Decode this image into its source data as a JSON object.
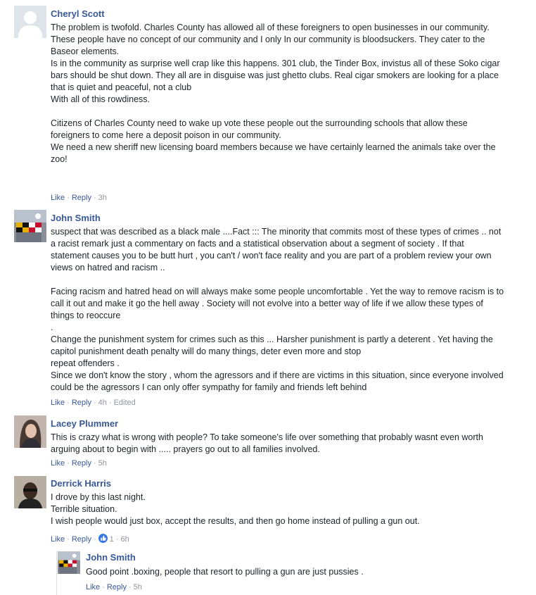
{
  "comments": [
    {
      "author": "Cheryl Scott",
      "text": "The problem is twofold. Charles County has allowed all of these foreigners to open businesses in our community.\nThese people have no concept of our community and I only In our community is bloodsuckers. They cater to the\nBaseor elements.\nIs in the community as surprise well crap like this happens. 301 club, the Tinder Box, invistus all of these Soko cigar\nbars should be shut down. They all are in disguise was just ghetto clubs. Real cigar smokers are looking for a place\nthat is quiet and peaceful, not a club\nWith all of this rowdiness.\n\nCitizens of Charles County need to wake up vote these people out the surrounding schools that allow these\nforeigners to come here a deposit poison in our community.\nWe need a new sheriff new licensing board members because we have certainly learned the animals take over the\nzoo!\n\n\n.",
      "like": "Like",
      "reply": "Reply",
      "time": "3h"
    },
    {
      "author": "John Smith",
      "text": "suspect that was described as a black male ....Fact ::: The minority that commits most of these types of crimes .. not\na racist remark just a commentary on facts and a statistical observation about a segment of society . If that\nstatement causes you to be butt hurt , you can't / won't face reality and you are part of a problem review your own\nviews on hatred and racism ..\n\nFacing racism and hatred head on will always make some people uncomfortable . Yet the way to remove racism is to\ncall it out and make it go the hell away . Society will not evolve into a better way of life if we allow these types of\nthings to reoccure\n.\nChange the punishment system for crimes such as this ... Harsher punishment is partly a deterent . Yet having the\ncapitol punishment death penalty will do many things, deter even more and stop\nrepeat offenders .\nSince we don't know the story , whom the agressors and if there are victims in this situation, since everyone involved\ncould be the agressors I can only offer sympathy for family and friends left behind",
      "like": "Like",
      "reply": "Reply",
      "time": "4h",
      "edited": "Edited"
    },
    {
      "author": "Lacey Plummer",
      "text": "This is crazy what is wrong with people? To take someone's life over something that probably wasnt even worth\narguing about to begin with ..... prayers go out to all families involved.",
      "like": "Like",
      "reply": "Reply",
      "time": "5h"
    },
    {
      "author": "Derrick Harris",
      "text": "I drove by this last night.\nTerrible situation.\nI wish people would just box, accept the results, and then go home instead of pulling a gun out.",
      "like": "Like",
      "reply": "Reply",
      "reaction_count": "1",
      "time": "6h"
    }
  ],
  "reply": {
    "author": "John Smith",
    "text": "Good point .boxing, people that resort to pulling a gun are just pussies .",
    "like": "Like",
    "reply": "Reply",
    "time": "5h"
  },
  "colors": {
    "name": "#385898",
    "text": "#1d2129",
    "meta": "#90949c",
    "like_icon": "#3578e5"
  }
}
